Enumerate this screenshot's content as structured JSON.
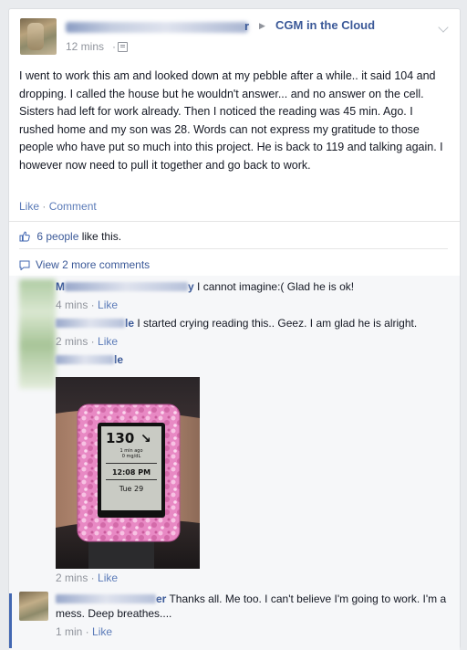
{
  "post": {
    "author_tail": "r",
    "group": "CGM in the Cloud",
    "time": "12 mins",
    "text": "I went to work this am and looked down at my pebble after a while.. it said 104 and dropping. I called the house but he wouldn't answer... and no answer on the cell. Sisters had left for work already. Then I noticed the reading was 45 min. Ago. I rushed home and my son was 28. Words can not express my gratitude to those people who have put so much into this project. He is back to 119 and talking again. I however now need to pull it together and go back to work.",
    "actions": {
      "like": "Like",
      "sep": "·",
      "comment": "Comment"
    },
    "likes": {
      "count_text": "6 people",
      "suffix": " like this."
    },
    "view_more": "View 2 more comments"
  },
  "comments": [
    {
      "name_prefix": "M",
      "name_tail": "y",
      "text": " I cannot imagine:( Glad he is ok!",
      "time": "4 mins",
      "like": "Like"
    },
    {
      "name_tail": "le",
      "text": " I started crying reading this.. Geez. I am glad he is alright.",
      "time": "2 mins",
      "like": "Like"
    },
    {
      "name_tail": "le",
      "text": "",
      "time": "2 mins",
      "like": "Like",
      "photo": {
        "reading": "130",
        "sub1": "1 min ago",
        "sub2": "0 mg/dL",
        "clock": "12:08 PM",
        "date": "Tue 29"
      }
    },
    {
      "name_tail": "er",
      "text": " Thanks all. Me too. I can't believe I'm going to work. I'm a mess. Deep breathes....",
      "time": "1 min",
      "like": "Like"
    }
  ],
  "colors": {
    "link": "#3b5998",
    "meta": "#90949c",
    "card_bg": "#ffffff",
    "page_bg": "#e9ebee"
  },
  "icons": [
    "audience-icon",
    "chevron-down-icon",
    "thumbs-up-icon",
    "comment-bubble-icon",
    "right-arrow-icon"
  ]
}
